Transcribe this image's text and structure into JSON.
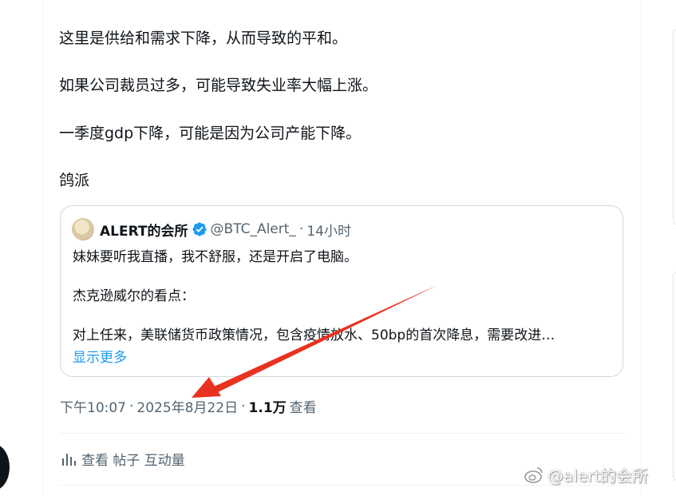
{
  "post": {
    "lines": [
      "这里是供给和需求下降，从而导致的平和。",
      "如果公司裁员过多，可能导致失业率大幅上涨。",
      "一季度gdp下降，可能是因为公司产能下降。",
      "鸽派"
    ]
  },
  "quoted_post": {
    "author_name": "ALERT的会所",
    "handle": "@BTC_Alert_",
    "separator": "·",
    "relative_time": "14小时",
    "lines": [
      "妹妹要听我直播，我不舒服，还是开启了电脑。",
      "杰克逊威尔的看点：",
      "对上任来，美联储货币政策情况，包含疫情放水、50bp的首次降息，需要改进…"
    ],
    "show_more": "显示更多"
  },
  "meta": {
    "time": "下午10:07",
    "separator": "·",
    "date": "2025年8月22日",
    "views_count": "1.1万",
    "views_label": "查看"
  },
  "actions": {
    "engagement_label": "查看 帖子 互动量"
  },
  "watermark": {
    "text": "@alert的会所"
  },
  "colors": {
    "text": "#0f1419",
    "secondary": "#536471",
    "link": "#1d9bf0",
    "verified": "#1d9bf0",
    "annotation_arrow": "#e8321f"
  },
  "icons": {
    "verified": "verified-badge-icon",
    "analytics": "bar-chart-icon",
    "watermark_logo": "weibo-logo-icon"
  }
}
